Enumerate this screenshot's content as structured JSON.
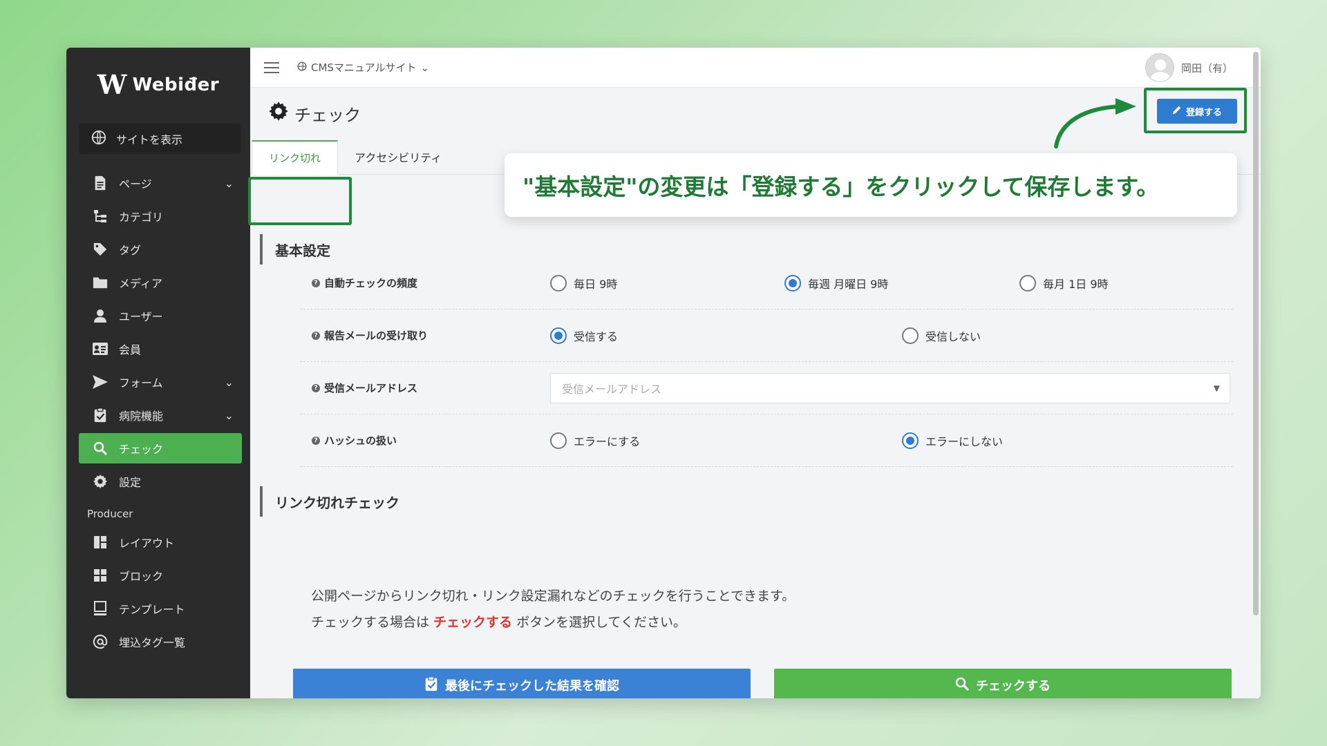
{
  "brand": {
    "logo_mark": "W",
    "logo_text": "Webiđer"
  },
  "sidebar": {
    "site_view": "サイトを表示",
    "items": [
      {
        "label": "ページ",
        "icon": "file-icon",
        "chevron": "⌄"
      },
      {
        "label": "カテゴリ",
        "icon": "tree-icon"
      },
      {
        "label": "タグ",
        "icon": "tag-icon"
      },
      {
        "label": "メディア",
        "icon": "folder-icon"
      },
      {
        "label": "ユーザー",
        "icon": "user-icon"
      },
      {
        "label": "会員",
        "icon": "id-card-icon"
      },
      {
        "label": "フォーム",
        "icon": "send-icon",
        "chevron": "⌄"
      },
      {
        "label": "病院機能",
        "icon": "clipboard-check-icon",
        "chevron": "⌄"
      },
      {
        "label": "チェック",
        "icon": "search-icon",
        "active": true
      },
      {
        "label": "設定",
        "icon": "gear-icon"
      }
    ],
    "section_producer": "Producer",
    "producer_items": [
      {
        "label": "レイアウト",
        "icon": "layout-icon"
      },
      {
        "label": "ブロック",
        "icon": "grid-icon"
      },
      {
        "label": "テンプレート",
        "icon": "monitor-icon"
      },
      {
        "label": "埋込タグ一覧",
        "icon": "at-icon"
      }
    ]
  },
  "topbar": {
    "site_name": "CMSマニュアルサイト",
    "site_caret": "⌄",
    "user_name": "岡田（有）"
  },
  "page": {
    "title": "チェック",
    "register_label": "登録する"
  },
  "tabs": [
    {
      "label": "リンク切れ"
    },
    {
      "label": "アクセシビリティ"
    }
  ],
  "basic": {
    "heading": "基本設定",
    "rows": [
      {
        "label": "自動チェックの頻度",
        "options": [
          "毎日 9時",
          "毎週 月曜日 9時",
          "毎月 1日 9時"
        ]
      },
      {
        "label": "報告メールの受け取り",
        "options": [
          "受信する",
          "受信しない"
        ]
      },
      {
        "label": "受信メールアドレス",
        "placeholder": "受信メールアドレス"
      },
      {
        "label": "ハッシュの扱い",
        "options": [
          "エラーにする",
          "エラーにしない"
        ]
      }
    ]
  },
  "linkcheck": {
    "heading": "リンク切れチェック",
    "desc_line1": "公開ページからリンク切れ・リンク設定漏れなどのチェックを行うことできます。",
    "desc_line2_pre": "チェックする場合は ",
    "desc_line2_emph": "チェックする",
    "desc_line2_post": " ボタンを選択してください。",
    "btn_last_result": "最後にチェックした結果を確認",
    "btn_check": "チェックする"
  },
  "callout": {
    "text": "\"基本設定\"の変更は「登録する」をクリックして保存します。"
  },
  "colors": {
    "accent_green": "#4caf50",
    "primary_blue": "#2e7bd0",
    "highlight": "#1f8a3c"
  }
}
